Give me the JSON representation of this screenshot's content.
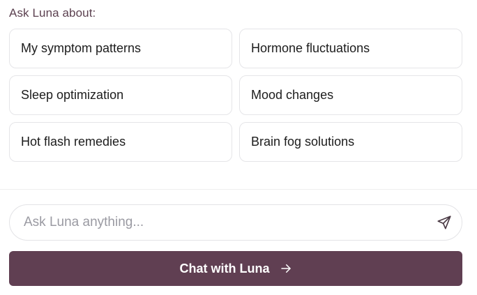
{
  "heading": "Ask Luna about:",
  "suggestions": [
    {
      "label": "My symptom patterns"
    },
    {
      "label": "Hormone fluctuations"
    },
    {
      "label": "Sleep optimization"
    },
    {
      "label": "Mood changes"
    },
    {
      "label": "Hot flash remedies"
    },
    {
      "label": "Brain fog solutions"
    }
  ],
  "input": {
    "placeholder": "Ask Luna anything...",
    "value": "",
    "send_icon": "send-icon"
  },
  "cta": {
    "label": "Chat with Luna",
    "icon": "arrow-right-icon"
  },
  "colors": {
    "accent": "#603f52",
    "heading": "#5c4150",
    "border": "#e5e5e8"
  }
}
